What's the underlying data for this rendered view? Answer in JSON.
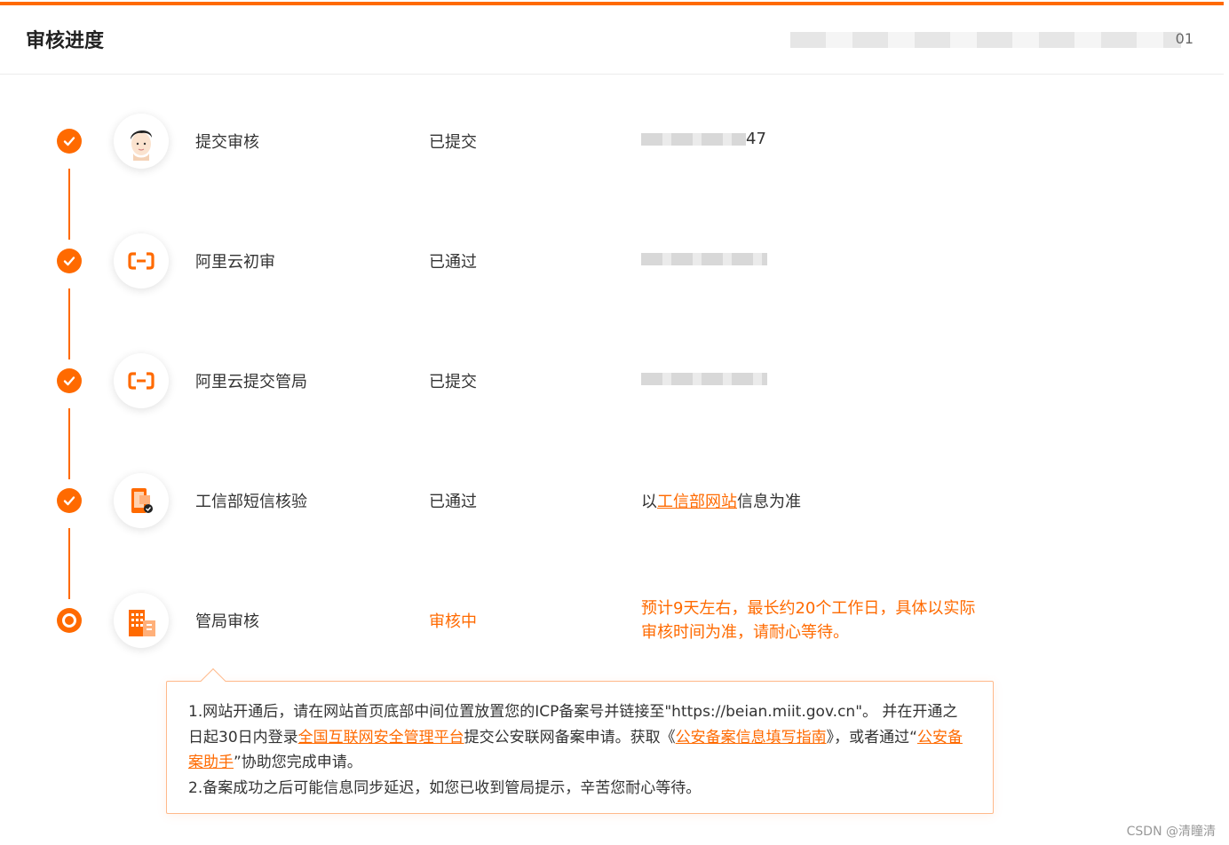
{
  "header": {
    "title": "审核进度",
    "meta_tail": "01"
  },
  "colors": {
    "accent": "#ff6a00",
    "text": "#333333",
    "tip_border": "#ffb98a"
  },
  "steps": [
    {
      "name": "提交审核",
      "status": "已提交",
      "detail_tail": "47",
      "icon": "user-avatar-icon",
      "state": "done"
    },
    {
      "name": "阿里云初审",
      "status": "已通过",
      "detail_tail": "",
      "icon": "aliyun-logo-icon",
      "state": "done"
    },
    {
      "name": "阿里云提交管局",
      "status": "已提交",
      "detail_tail": "",
      "icon": "aliyun-logo-icon",
      "state": "done"
    },
    {
      "name": "工信部短信核验",
      "status": "已通过",
      "detail_prefix": "以",
      "detail_link": "工信部网站",
      "detail_suffix": "信息为准",
      "icon": "phone-verify-icon",
      "state": "done"
    },
    {
      "name": "管局审核",
      "status": "审核中",
      "detail": "预计9天左右，最长约20个工作日，具体以实际审核时间为准，请耐心等待。",
      "icon": "building-icon",
      "state": "active"
    }
  ],
  "tip": {
    "line1_a": "1.网站开通后，请在网站首页底部中间位置放置您的ICP备案号并链接至\"https://beian.miit.gov.cn\"。 并在开通之日起30日内登录",
    "link1": "全国互联网安全管理平台",
    "line1_b": "提交公安联网备案申请。获取《",
    "link2": "公安备案信息填写指南",
    "line1_c": "》，或者通过“",
    "link3": "公安备案助手",
    "line1_d": "”协助您完成申请。",
    "line2": "2.备案成功之后可能信息同步延迟，如您已收到管局提示，辛苦您耐心等待。"
  },
  "watermark": "CSDN @清瞳清"
}
